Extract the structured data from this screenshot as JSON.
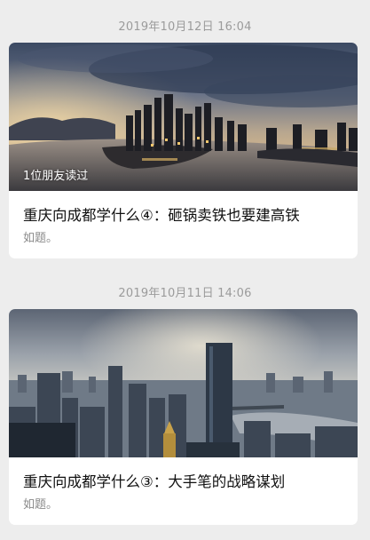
{
  "feed": {
    "articles": [
      {
        "timestamp": "2019年10月12日 16:04",
        "image_alt": "Chongqing skyline at dusk over the river",
        "read_badge": "1位朋友读过",
        "title": "重庆向成都学什么④：砸锅卖铁也要建高铁",
        "description": "如题。"
      },
      {
        "timestamp": "2019年10月11日 14:06",
        "image_alt": "Aerial view of city skyscrapers and river",
        "title": "重庆向成都学什么③：大手笔的战略谋划",
        "description": "如题。"
      }
    ]
  }
}
